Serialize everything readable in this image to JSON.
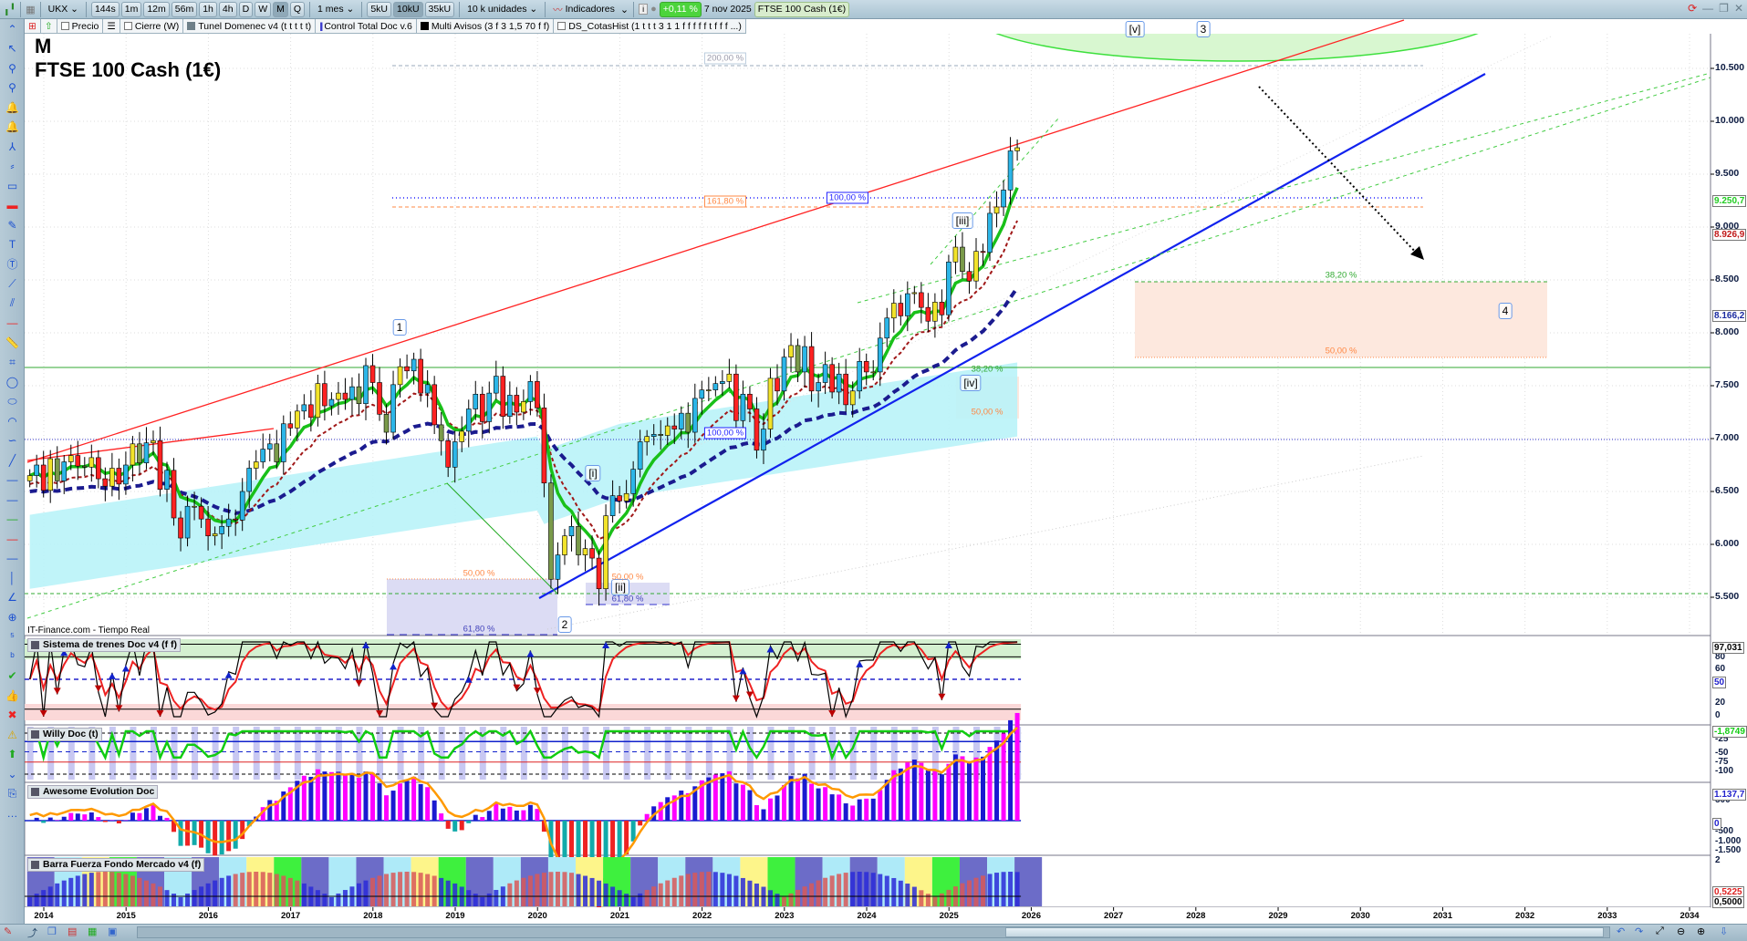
{
  "toolbar": {
    "symbol": "UKX",
    "intervals": [
      "144s",
      "1m",
      "12m",
      "56m",
      "1h",
      "4h",
      "D",
      "W",
      "M",
      "Q"
    ],
    "active_interval": "M",
    "period": "1 mes",
    "units": [
      "5kU",
      "10kU",
      "35kU"
    ],
    "active_unit": "10kU",
    "units_select": "10 k unidades",
    "indicators": "Indicadores",
    "change": "+0,11 %",
    "date": "7 nov 2025",
    "instrument": "FTSE 100 Cash (1€)"
  },
  "tabs": [
    {
      "label": "Precio",
      "mark": "checkbox"
    },
    {
      "label": "",
      "mark": "list"
    },
    {
      "label": "Cierre (W)",
      "mark": "checkbox"
    },
    {
      "label": "Tunel Domenec v4 (t t t t t)",
      "mark": "#6e7f88"
    },
    {
      "label": "Control Total Doc v.6",
      "mark": "bars"
    },
    {
      "label": "Multi Avisos (3 f 3 1,5 70 f f)",
      "mark": "#000000"
    },
    {
      "label": "DS_CotasHist (1 t t t 3 1 1 f f f f f t f f f ...)",
      "mark": "checkbox"
    }
  ],
  "chart": {
    "timeframe": "M",
    "title": "FTSE 100 Cash (1€)",
    "source": "IT-Finance.com - Tiempo Real",
    "price_axis": [
      "10.500",
      "10.000",
      "9.500",
      "9.000",
      "8.500",
      "8.000",
      "7.500",
      "7.000",
      "6.500",
      "6.000",
      "5.500"
    ],
    "price_tags": [
      {
        "text": "9.250,7",
        "color": "#22cc22"
      },
      {
        "text": "8.926,9",
        "color": "#c01818"
      },
      {
        "text": "8.166,2",
        "color": "#1a2aa0"
      }
    ],
    "wave_labels": {
      "w1": "1",
      "w2": "2",
      "w3": "3",
      "w4": "4",
      "wi": "[i]",
      "wii": "[ii]",
      "wiii": "[iii]",
      "wiv": "[iv]",
      "wv": "[v]"
    },
    "fib_labels": {
      "f200": "200,00 %",
      "f1618": "161,80 %",
      "f100a": "100,00 %",
      "f100b": "100,00 %",
      "f382a": "38,20 %",
      "f50a": "50,00 %",
      "f382b": "38,20 %",
      "f50b": "50,00 %",
      "f50c": "50,00 %",
      "f618a": "61,80 %",
      "f50d": "50,00 %",
      "f618b": "61,80 %"
    },
    "years": [
      "2014",
      "2015",
      "2016",
      "2017",
      "2018",
      "2019",
      "2020",
      "2021",
      "2022",
      "2023",
      "2024",
      "2025",
      "2026",
      "2027",
      "2028",
      "2029",
      "2030",
      "2031",
      "2032",
      "2033",
      "2034"
    ]
  },
  "panels": [
    {
      "title": "Sistema de trenes Doc v4 (f f)",
      "axis": [
        "80",
        "60",
        "40",
        "20",
        "0"
      ],
      "tags": [
        "97,031",
        "50"
      ]
    },
    {
      "title": "Willy Doc (t)",
      "axis": [
        "-25",
        "-50",
        "-75",
        "-100"
      ],
      "tags": [
        "-1,8749"
      ]
    },
    {
      "title": "Awesome Evolution Doc",
      "axis": [
        "500",
        "-500",
        "-1.000",
        "-1.500"
      ],
      "tags": [
        "1.137,7",
        "0"
      ]
    },
    {
      "title": "Barra Fuerza Fondo Mercado v4 (f)",
      "axis": [
        "2"
      ],
      "tags": [
        "0,5225",
        "0,5000"
      ]
    }
  ],
  "chart_data": {
    "type": "candlestick",
    "interval": "monthly",
    "start": "2013-11",
    "closes": [
      6650,
      6750,
      6510,
      6810,
      6600,
      6780,
      6840,
      6740,
      6730,
      6820,
      6620,
      6550,
      6720,
      6570,
      6750,
      6950,
      6770,
      6960,
      6980,
      6520,
      6700,
      6250,
      6060,
      6360,
      6360,
      6240,
      6080,
      6100,
      6170,
      6240,
      6230,
      6500,
      6720,
      6780,
      6900,
      6950,
      6780,
      7140,
      7100,
      7260,
      7320,
      7200,
      7520,
      7310,
      7370,
      7430,
      7370,
      7490,
      7330,
      7690,
      7530,
      7230,
      7060,
      7510,
      7680,
      7640,
      7750,
      7430,
      7510,
      7130,
      6980,
      6730,
      6970,
      7070,
      7280,
      7420,
      7160,
      7430,
      7590,
      7210,
      7410,
      7250,
      7350,
      7540,
      7290,
      6580,
      5670,
      5900,
      6080,
      6170,
      5900,
      5960,
      5870,
      5580,
      6270,
      6460,
      6410,
      6480,
      6710,
      6970,
      7020,
      7040,
      7030,
      7120,
      7090,
      7240,
      7060,
      7380,
      7460,
      7460,
      7520,
      7540,
      7610,
      7170,
      7420,
      7280,
      6890,
      7090,
      7570,
      7450,
      7770,
      7880,
      7630,
      7870,
      7450,
      7530,
      7700,
      7440,
      7610,
      7320,
      7450,
      7730,
      7630,
      7630,
      7950,
      8140,
      8280,
      8160,
      8370,
      8380,
      8240,
      8110,
      8290,
      8170,
      8670,
      8810,
      8580,
      8490,
      8770,
      8760,
      9130,
      9190,
      9350,
      9720,
      9750
    ]
  }
}
